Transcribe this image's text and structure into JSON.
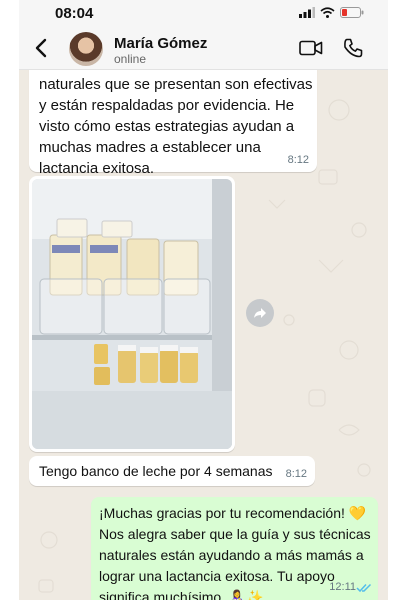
{
  "status_bar": {
    "time": "08:04"
  },
  "header": {
    "contact_name": "María Gómez",
    "contact_status": "online"
  },
  "messages": [
    {
      "text": "naturales que se presentan son efectivas y están respaldadas por evidencia. He visto cómo estas estrategias ayudan a muchas madres a establecer una lactancia exitosa.",
      "time": "8:12"
    },
    {
      "text": "Tengo banco de leche por 4 semanas",
      "time": "8:12"
    },
    {
      "text": "¡Muchas gracias por tu recomendación! 💛 Nos alegra saber que la guía y sus técnicas naturales están ayudando a más mamás a lograr una lactancia exitosa. Tu apoyo significa muchísimo. 👩‍🍼✨",
      "time": "12:11"
    }
  ],
  "colors": {
    "chat_bg": "#efeae2",
    "incoming_bubble": "#ffffff",
    "outgoing_bubble": "#d9fdd3",
    "read_ticks": "#53bdeb"
  },
  "icons": [
    "back-arrow-icon",
    "video-call-icon",
    "voice-call-icon",
    "forward-icon",
    "read-ticks-icon"
  ]
}
